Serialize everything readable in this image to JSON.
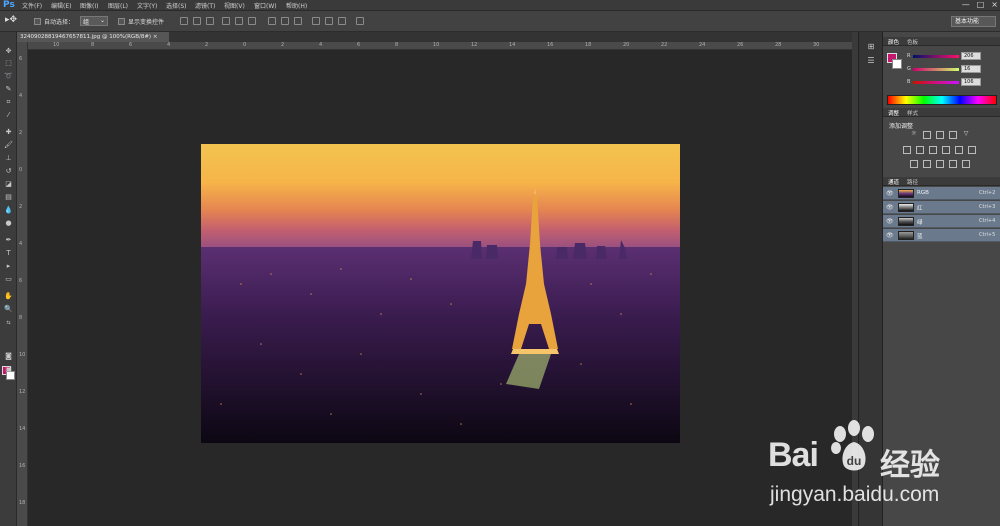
{
  "app": {
    "logo": "Ps",
    "menus": [
      "文件(F)",
      "编辑(E)",
      "图像(I)",
      "图层(L)",
      "文字(Y)",
      "选择(S)",
      "滤镜(T)",
      "视图(V)",
      "窗口(W)",
      "帮助(H)"
    ],
    "window_controls": [
      "—",
      "□",
      "×"
    ]
  },
  "options": {
    "auto_select_label": "自动选择：",
    "auto_select_value": "组",
    "show_transform_label": "显示变换控件",
    "workspace": "基本功能"
  },
  "document": {
    "tab_title": "32409028819467657811.jpg @ 100%(RGB/8#)",
    "tab_close": "×",
    "ruler_top_ticks": [
      "10",
      "8",
      "6",
      "4",
      "2",
      "0",
      "2",
      "4",
      "6",
      "8",
      "10",
      "12",
      "14",
      "16",
      "18",
      "20",
      "22",
      "24",
      "26",
      "28",
      "30"
    ],
    "ruler_left_ticks": [
      "6",
      "4",
      "2",
      "0",
      "2",
      "4",
      "6",
      "8",
      "10",
      "12",
      "14",
      "16",
      "18"
    ]
  },
  "panels": {
    "color": {
      "tabs": [
        "颜色",
        "色板"
      ],
      "r": {
        "label": "R",
        "value": "206"
      },
      "g": {
        "label": "G",
        "value": "16"
      },
      "b": {
        "label": "B",
        "value": "106"
      }
    },
    "adjustments": {
      "tabs": [
        "调整",
        "样式"
      ],
      "title": "添加调整"
    },
    "channels": {
      "tabs": [
        "通道",
        "路径"
      ],
      "rows": [
        {
          "name": "RGB",
          "shortcut": "Ctrl+2"
        },
        {
          "name": "红",
          "shortcut": "Ctrl+3"
        },
        {
          "name": "绿",
          "shortcut": "Ctrl+4"
        },
        {
          "name": "蓝",
          "shortcut": "Ctrl+5"
        }
      ]
    }
  },
  "watermark": {
    "bai": "Bai",
    "du": "du",
    "cn": "经验",
    "url": "jingyan.baidu.com"
  },
  "colors": {
    "foreground": "#c4186c",
    "background": "#ffffff"
  }
}
